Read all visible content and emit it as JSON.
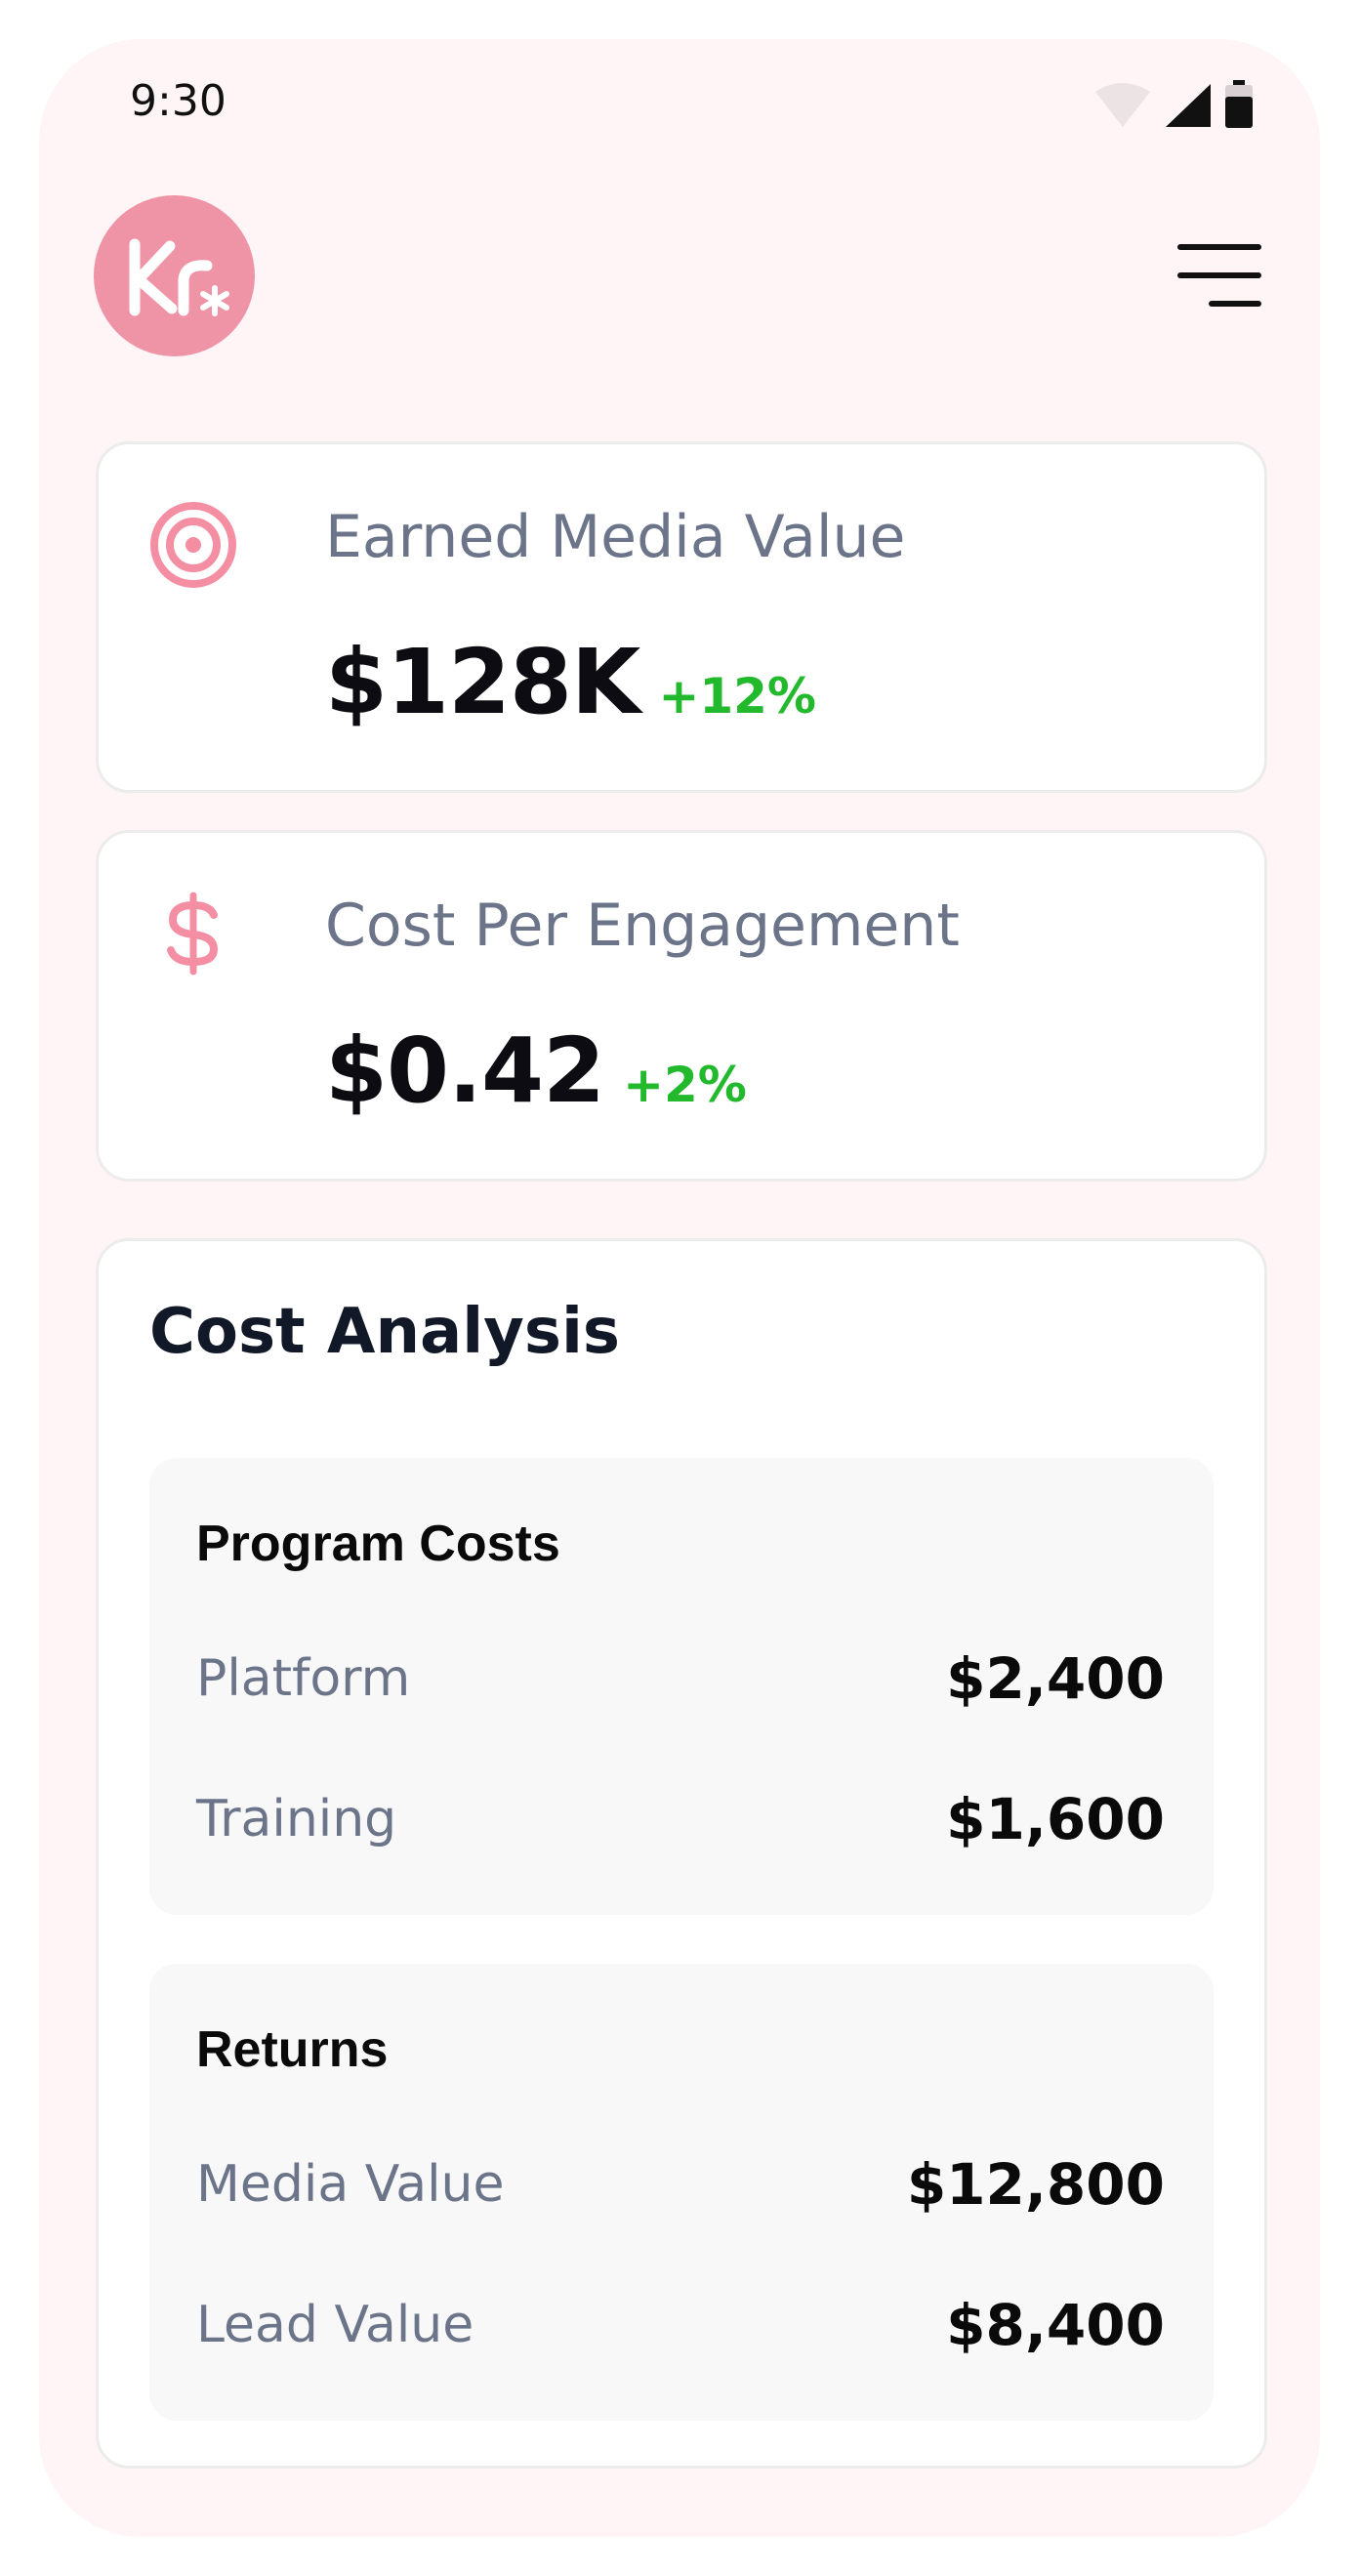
{
  "status_bar": {
    "time": "9:30"
  },
  "header": {
    "logo_text": "Kr",
    "logo_icon": "asterisk-icon",
    "menu_icon": "menu-icon"
  },
  "colors": {
    "accent": "#ef93a6",
    "positive": "#22b92d",
    "muted_text": "#6b7489",
    "phone_background": "#fff5f6"
  },
  "metrics": [
    {
      "icon": "target-icon",
      "label": "Earned Media Value",
      "value": "$128K",
      "change": "+12%"
    },
    {
      "icon": "dollar-icon",
      "label": "Cost Per Engagement",
      "value": "$0.42",
      "change": "+2%"
    }
  ],
  "cost_analysis": {
    "title": "Cost Analysis",
    "sections": [
      {
        "title": "Program Costs",
        "rows": [
          {
            "label": "Platform",
            "value": "$2,400"
          },
          {
            "label": "Training",
            "value": "$1,600"
          }
        ]
      },
      {
        "title": "Returns",
        "rows": [
          {
            "label": "Media Value",
            "value": "$12,800"
          },
          {
            "label": "Lead Value",
            "value": "$8,400"
          }
        ]
      }
    ]
  }
}
